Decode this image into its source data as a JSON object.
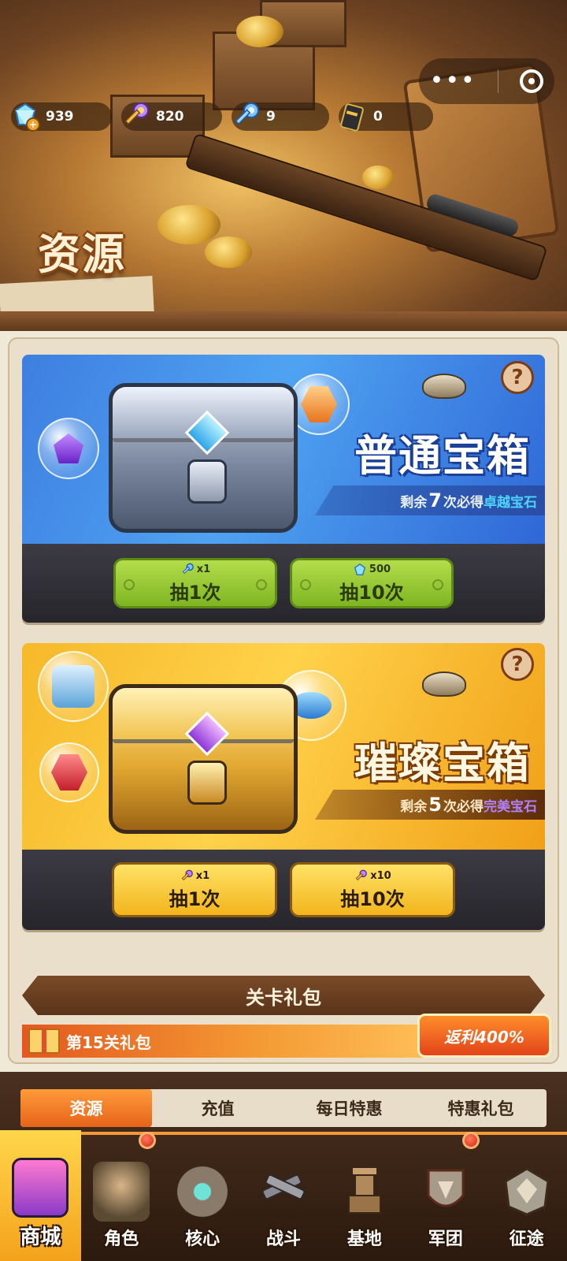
{
  "header": {
    "title": "资源",
    "resources": [
      {
        "icon": "diamond-plus-icon",
        "value": "939"
      },
      {
        "icon": "purple-key-icon",
        "value": "820"
      },
      {
        "icon": "blue-key-icon",
        "value": "9"
      },
      {
        "icon": "card-pack-icon",
        "value": "0"
      }
    ],
    "capsule": {
      "more_icon": "more-dots-icon",
      "close_icon": "target-icon"
    }
  },
  "chests": [
    {
      "name": "普通宝箱",
      "theme": "blue",
      "remain_prefix": "剩余",
      "remain_count": "7",
      "remain_mid": "次必得",
      "remain_prize": "卓越宝石",
      "buttons": [
        {
          "cost_icon": "blue-key-icon",
          "cost": "x1",
          "label": "抽1次"
        },
        {
          "cost_icon": "diamond-icon",
          "cost": "500",
          "label": "抽10次"
        }
      ]
    },
    {
      "name": "璀璨宝箱",
      "theme": "gold",
      "remain_prefix": "剩余",
      "remain_count": "5",
      "remain_mid": "次必得",
      "remain_prize": "完美宝石",
      "buttons": [
        {
          "cost_icon": "purple-key-icon",
          "cost": "x1",
          "label": "抽1次"
        },
        {
          "cost_icon": "purple-key-icon",
          "cost": "x10",
          "label": "抽10次"
        }
      ]
    }
  ],
  "gift_section": {
    "title": "关卡礼包",
    "item": {
      "label": "第15关礼包",
      "rebate": "返利400%"
    }
  },
  "tabs": [
    {
      "label": "资源",
      "active": true
    },
    {
      "label": "充值",
      "active": false
    },
    {
      "label": "每日特惠",
      "active": false
    },
    {
      "label": "特惠礼包",
      "active": false
    }
  ],
  "nav": [
    {
      "label": "商城",
      "active": true,
      "badge": false
    },
    {
      "label": "角色",
      "active": false,
      "badge": true
    },
    {
      "label": "核心",
      "active": false,
      "badge": false
    },
    {
      "label": "战斗",
      "active": false,
      "badge": false
    },
    {
      "label": "基地",
      "active": false,
      "badge": false
    },
    {
      "label": "军团",
      "active": false,
      "badge": true
    },
    {
      "label": "征途",
      "active": false,
      "badge": false
    }
  ],
  "colors": {
    "accent": "#f29a3a",
    "blue_chest": "#3e7ee0",
    "gold_chest": "#f6b92a",
    "green_button": "#9ccb35"
  }
}
